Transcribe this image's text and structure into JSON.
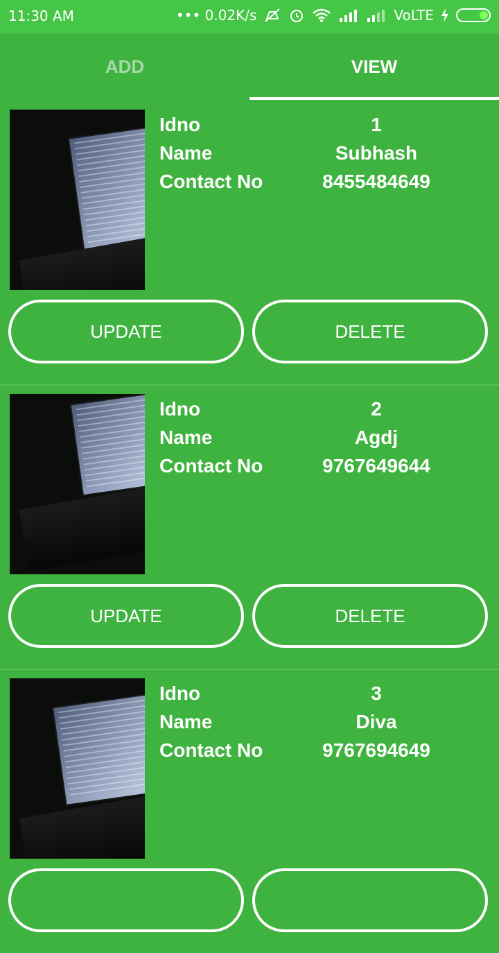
{
  "status_bar": {
    "time": "11:30 AM",
    "net_speed": "••• 0.02K/s",
    "network_label": "VoLTE"
  },
  "tabs": [
    {
      "label": "ADD",
      "selected": false
    },
    {
      "label": "VIEW",
      "selected": true
    }
  ],
  "field_labels": {
    "idno": "Idno",
    "name": "Name",
    "contact": "Contact No"
  },
  "buttons": {
    "update": "UPDATE",
    "delete": "DELETE"
  },
  "records": [
    {
      "idno": "1",
      "name": "Subhash",
      "contact": "8455484649"
    },
    {
      "idno": "2",
      "name": "Agdj",
      "contact": "9767649644"
    },
    {
      "idno": "3",
      "name": "Diva",
      "contact": "9767694649"
    }
  ],
  "colors": {
    "background": "#3fb33f",
    "status_bar": "#46c646",
    "tab_inactive": "#a9d8a9",
    "text": "#ffffff"
  }
}
